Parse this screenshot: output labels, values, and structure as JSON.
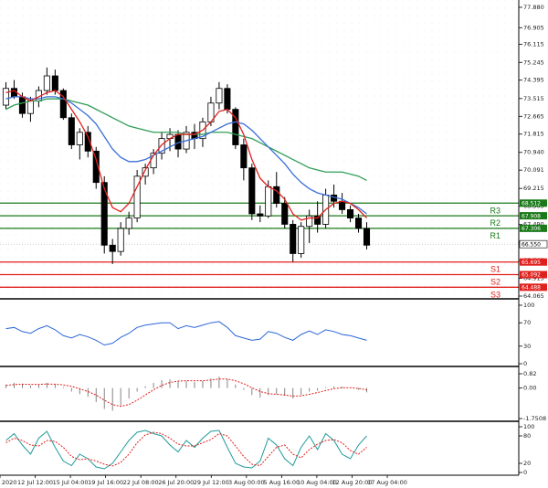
{
  "chart_data": {
    "type": "candlestick",
    "price_axis": {
      "ticks": [
        "77.880",
        "76.905",
        "76.115",
        "75.245",
        "74.395",
        "73.515",
        "72.665",
        "71.815",
        "70.940",
        "70.091",
        "69.215",
        "68.363",
        "67.490",
        "66.615",
        "65.765",
        "64.915",
        "64.065"
      ],
      "range": [
        64.065,
        77.88
      ]
    },
    "levels": [
      {
        "name": "R3",
        "value": 68.512,
        "label": "68.512",
        "color": "#1a7a1a"
      },
      {
        "name": "R2",
        "value": 67.908,
        "label": "67.908",
        "color": "#1a7a1a"
      },
      {
        "name": "R1",
        "value": 67.306,
        "label": "67.306",
        "color": "#1a7a1a"
      },
      {
        "name": "S1",
        "value": 65.695,
        "label": "65.695",
        "color": "#e0201c"
      },
      {
        "name": "S2",
        "value": 65.092,
        "label": "65.092",
        "color": "#e0201c"
      },
      {
        "name": "S3",
        "value": 64.488,
        "label": "64.488",
        "color": "#e0201c"
      }
    ],
    "current_price": {
      "value": 66.55,
      "label": "66.550"
    },
    "x_labels": [
      "10 Jul 2020",
      "12 Jul 12:00",
      "15 Jul 04:00",
      "19 Jul 16:00",
      "22 Jul 08:00",
      "26 Jul 20:00",
      "29 Jul 12:00",
      "3 Aug 00:00",
      "5 Aug 16:00",
      "10 Aug 04:00",
      "12 Aug 20:00",
      "17 Aug 04:00"
    ],
    "candles": [
      [
        73.2,
        74.3,
        73.0,
        74.0
      ],
      [
        74.0,
        74.4,
        73.5,
        73.6
      ],
      [
        73.6,
        73.8,
        72.6,
        72.8
      ],
      [
        72.8,
        73.6,
        72.4,
        73.4
      ],
      [
        73.4,
        74.1,
        73.1,
        73.9
      ],
      [
        73.9,
        75.0,
        73.7,
        74.6
      ],
      [
        74.6,
        74.9,
        73.7,
        73.9
      ],
      [
        73.9,
        74.0,
        72.5,
        72.6
      ],
      [
        72.6,
        72.8,
        71.1,
        71.3
      ],
      [
        71.3,
        72.1,
        70.6,
        71.9
      ],
      [
        71.9,
        72.2,
        70.7,
        71.0
      ],
      [
        71.0,
        71.2,
        69.2,
        69.5
      ],
      [
        69.5,
        69.8,
        66.1,
        66.5
      ],
      [
        66.5,
        66.8,
        65.6,
        66.2
      ],
      [
        66.2,
        67.6,
        66.0,
        67.3
      ],
      [
        67.3,
        68.1,
        67.0,
        67.8
      ],
      [
        67.8,
        70.1,
        67.6,
        69.8
      ],
      [
        69.8,
        70.4,
        69.4,
        70.2
      ],
      [
        70.2,
        71.1,
        69.9,
        70.9
      ],
      [
        70.9,
        71.9,
        70.6,
        71.6
      ],
      [
        71.6,
        72.1,
        71.0,
        71.8
      ],
      [
        71.8,
        72.0,
        70.7,
        71.1
      ],
      [
        71.1,
        72.2,
        70.9,
        71.9
      ],
      [
        71.9,
        72.3,
        71.1,
        71.6
      ],
      [
        71.6,
        72.6,
        71.2,
        72.4
      ],
      [
        72.4,
        73.6,
        72.2,
        73.3
      ],
      [
        73.3,
        74.3,
        73.0,
        74.0
      ],
      [
        74.0,
        74.2,
        72.8,
        73.0
      ],
      [
        73.0,
        73.1,
        71.1,
        71.3
      ],
      [
        71.3,
        71.6,
        69.6,
        70.2
      ],
      [
        70.2,
        70.4,
        67.7,
        68.0
      ],
      [
        68.0,
        68.4,
        67.6,
        67.9
      ],
      [
        67.9,
        69.6,
        67.8,
        69.3
      ],
      [
        69.3,
        70.0,
        68.3,
        68.5
      ],
      [
        68.5,
        68.8,
        67.3,
        67.5
      ],
      [
        67.5,
        67.7,
        65.7,
        66.1
      ],
      [
        66.1,
        67.6,
        65.9,
        67.4
      ],
      [
        67.4,
        68.2,
        66.6,
        67.9
      ],
      [
        67.9,
        68.6,
        67.1,
        67.5
      ],
      [
        67.5,
        69.2,
        67.3,
        68.9
      ],
      [
        68.9,
        69.4,
        68.3,
        68.6
      ],
      [
        68.6,
        69.0,
        68.0,
        68.2
      ],
      [
        68.2,
        68.4,
        67.6,
        67.8
      ],
      [
        67.8,
        68.0,
        67.1,
        67.3
      ],
      [
        67.3,
        67.6,
        66.3,
        66.5
      ]
    ],
    "ma_red": [
      73.8,
      73.9,
      73.6,
      73.4,
      73.6,
      73.8,
      73.9,
      73.6,
      73.0,
      72.4,
      71.7,
      70.6,
      69.2,
      68.3,
      68.1,
      68.5,
      69.3,
      70.1,
      70.8,
      71.3,
      71.6,
      71.8,
      71.8,
      71.8,
      72.0,
      72.4,
      72.9,
      73.0,
      72.6,
      71.8,
      70.6,
      69.7,
      69.3,
      69.1,
      68.7,
      68.0,
      67.7,
      67.8,
      67.8,
      68.2,
      68.5,
      68.6,
      68.5,
      68.2,
      67.8
    ],
    "ma_blue": [
      73.5,
      73.6,
      73.6,
      73.5,
      73.5,
      73.6,
      73.6,
      73.5,
      73.3,
      73.0,
      72.7,
      72.3,
      71.7,
      71.1,
      70.7,
      70.5,
      70.5,
      70.6,
      70.8,
      71.0,
      71.2,
      71.4,
      71.5,
      71.6,
      71.7,
      71.9,
      72.1,
      72.3,
      72.4,
      72.3,
      72.0,
      71.6,
      71.2,
      70.8,
      70.4,
      69.9,
      69.5,
      69.2,
      69.0,
      68.9,
      68.8,
      68.7,
      68.5,
      68.3,
      68.0
    ],
    "ma_green": [
      73.0,
      73.2,
      73.3,
      73.4,
      73.4,
      73.5,
      73.5,
      73.5,
      73.4,
      73.3,
      73.2,
      73.0,
      72.8,
      72.6,
      72.4,
      72.2,
      72.1,
      72.0,
      71.9,
      71.9,
      71.9,
      71.9,
      71.8,
      71.8,
      71.8,
      71.9,
      71.9,
      71.9,
      71.8,
      71.7,
      71.6,
      71.4,
      71.2,
      71.0,
      70.8,
      70.6,
      70.4,
      70.2,
      70.1,
      70.0,
      70.0,
      70.0,
      69.9,
      69.8,
      69.6
    ],
    "rsi": {
      "ticks": [
        "100",
        "70",
        "30",
        "0"
      ],
      "values": [
        60,
        62,
        55,
        52,
        60,
        65,
        58,
        48,
        44,
        50,
        46,
        40,
        32,
        35,
        45,
        52,
        62,
        66,
        68,
        70,
        70,
        60,
        65,
        62,
        66,
        70,
        72,
        62,
        48,
        44,
        40,
        42,
        55,
        52,
        45,
        40,
        50,
        56,
        50,
        58,
        55,
        50,
        48,
        44,
        40
      ]
    },
    "macd": {
      "ticks": [
        "0.82",
        "0.00",
        "-1.7508"
      ],
      "histogram": [
        0.2,
        0.3,
        0.25,
        0.15,
        0.22,
        0.3,
        0.2,
        0.05,
        -0.2,
        -0.35,
        -0.5,
        -0.8,
        -1.2,
        -1.3,
        -1.0,
        -0.6,
        -0.2,
        0.1,
        0.3,
        0.45,
        0.5,
        0.4,
        0.4,
        0.35,
        0.4,
        0.55,
        0.65,
        0.5,
        0.2,
        -0.1,
        -0.4,
        -0.55,
        -0.4,
        -0.35,
        -0.45,
        -0.6,
        -0.4,
        -0.2,
        -0.15,
        0.05,
        0.1,
        0.08,
        0.0,
        -0.1,
        -0.25
      ],
      "signal": [
        0.15,
        0.2,
        0.22,
        0.21,
        0.21,
        0.23,
        0.22,
        0.18,
        0.1,
        -0.05,
        -0.2,
        -0.4,
        -0.7,
        -0.95,
        -1.05,
        -0.95,
        -0.7,
        -0.4,
        -0.1,
        0.15,
        0.32,
        0.4,
        0.42,
        0.42,
        0.42,
        0.46,
        0.52,
        0.52,
        0.42,
        0.25,
        0.02,
        -0.2,
        -0.32,
        -0.36,
        -0.4,
        -0.46,
        -0.45,
        -0.36,
        -0.26,
        -0.14,
        -0.04,
        0.02,
        0.02,
        -0.02,
        -0.1
      ]
    },
    "stochastic": {
      "ticks": [
        "100",
        "80",
        "20",
        "0"
      ],
      "k": [
        70,
        85,
        60,
        40,
        75,
        90,
        55,
        25,
        15,
        40,
        30,
        12,
        8,
        20,
        45,
        70,
        88,
        92,
        85,
        80,
        60,
        45,
        70,
        55,
        75,
        90,
        92,
        55,
        20,
        12,
        10,
        25,
        75,
        60,
        30,
        15,
        55,
        80,
        50,
        85,
        70,
        40,
        30,
        60,
        80
      ],
      "d": [
        65,
        75,
        70,
        60,
        58,
        70,
        68,
        55,
        35,
        28,
        30,
        25,
        18,
        14,
        22,
        40,
        65,
        82,
        88,
        85,
        75,
        62,
        58,
        58,
        65,
        72,
        85,
        80,
        58,
        35,
        18,
        15,
        35,
        55,
        60,
        40,
        32,
        50,
        62,
        70,
        72,
        65,
        48,
        40,
        55
      ]
    }
  }
}
